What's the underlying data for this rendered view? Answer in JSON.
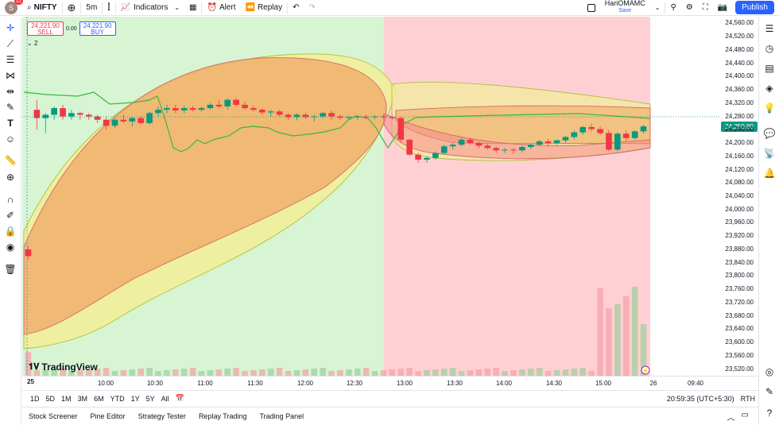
{
  "topbar": {
    "avatar_letter": "S",
    "notification_count": "11",
    "symbol": "NIFTY",
    "interval": "5m",
    "indicators_label": "Indicators",
    "alert_label": "Alert",
    "replay_label": "Replay",
    "layout_name": "HariOMAMC",
    "save_label": "Save",
    "publish_label": "Publish"
  },
  "quote": {
    "sell_price": "24,221.90",
    "sell_label": "SELL",
    "spread": "0.00",
    "buy_price": "24,221.90",
    "buy_label": "BUY",
    "legend_count": "2"
  },
  "price_axis": {
    "ticks": [
      "24,560.00",
      "24,520.00",
      "24,480.00",
      "24,440.00",
      "24,400.00",
      "24,360.00",
      "24,320.00",
      "24,280.00",
      "24,240.00",
      "24,200.00",
      "24,160.00",
      "24,120.00",
      "24,080.00",
      "24,040.00",
      "24,000.00",
      "23,960.00",
      "23,920.00",
      "23,880.00",
      "23,840.00",
      "23,800.00",
      "23,760.00",
      "23,720.00",
      "23,680.00",
      "23,640.00",
      "23,600.00",
      "23,560.00",
      "23,520.00"
    ],
    "last_price": "24,250.80",
    "last_price_color": "#089981"
  },
  "time_axis": {
    "day_label": "25",
    "ticks": [
      "10:00",
      "10:30",
      "11:00",
      "11:30",
      "12:00",
      "12:30",
      "13:00",
      "13:30",
      "14:00",
      "14:30",
      "15:00",
      "26",
      "09:40"
    ]
  },
  "watermark": "TradingView",
  "ranges": [
    "1D",
    "5D",
    "1M",
    "3M",
    "6M",
    "YTD",
    "1Y",
    "5Y",
    "All"
  ],
  "clock": "20:59:35 (UTC+5:30)",
  "session": "RTH",
  "bottom_tabs": [
    "Stock Screener",
    "Pine Editor",
    "Strategy Tester",
    "Replay Trading",
    "Trading Panel"
  ],
  "colors": {
    "up": "#089981",
    "down": "#f23645",
    "bg_green": "#d7f5d3",
    "bg_red": "#ffd0d3",
    "band_orange": "#f0b36f",
    "band_yellow": "#f2ee9a",
    "line_green": "#3cb83c",
    "accent": "#2962ff"
  },
  "chart_data": {
    "type": "candlestick",
    "y_range": [
      23500,
      24580
    ],
    "candles": [
      {
        "o": 23880,
        "h": 23890,
        "l": 23850,
        "c": 23860
      },
      {
        "o": 24300,
        "h": 24330,
        "l": 24240,
        "c": 24275
      },
      {
        "o": 24275,
        "h": 24290,
        "l": 24230,
        "c": 24285
      },
      {
        "o": 24285,
        "h": 24310,
        "l": 24270,
        "c": 24305
      },
      {
        "o": 24305,
        "h": 24315,
        "l": 24270,
        "c": 24280
      },
      {
        "o": 24280,
        "h": 24300,
        "l": 24270,
        "c": 24290
      },
      {
        "o": 24290,
        "h": 24295,
        "l": 24270,
        "c": 24285
      },
      {
        "o": 24285,
        "h": 24290,
        "l": 24270,
        "c": 24280
      },
      {
        "o": 24280,
        "h": 24285,
        "l": 24260,
        "c": 24270
      },
      {
        "o": 24270,
        "h": 24280,
        "l": 24240,
        "c": 24252
      },
      {
        "o": 24252,
        "h": 24275,
        "l": 24245,
        "c": 24270
      },
      {
        "o": 24270,
        "h": 24285,
        "l": 24260,
        "c": 24265
      },
      {
        "o": 24265,
        "h": 24280,
        "l": 24250,
        "c": 24275
      },
      {
        "o": 24275,
        "h": 24280,
        "l": 24255,
        "c": 24260
      },
      {
        "o": 24260,
        "h": 24295,
        "l": 24255,
        "c": 24290
      },
      {
        "o": 24290,
        "h": 24310,
        "l": 24280,
        "c": 24300
      },
      {
        "o": 24300,
        "h": 24315,
        "l": 24290,
        "c": 24305
      },
      {
        "o": 24305,
        "h": 24315,
        "l": 24290,
        "c": 24298
      },
      {
        "o": 24298,
        "h": 24312,
        "l": 24290,
        "c": 24305
      },
      {
        "o": 24305,
        "h": 24312,
        "l": 24295,
        "c": 24300
      },
      {
        "o": 24300,
        "h": 24310,
        "l": 24295,
        "c": 24305
      },
      {
        "o": 24305,
        "h": 24320,
        "l": 24300,
        "c": 24315
      },
      {
        "o": 24315,
        "h": 24330,
        "l": 24305,
        "c": 24310
      },
      {
        "o": 24310,
        "h": 24335,
        "l": 24300,
        "c": 24330
      },
      {
        "o": 24330,
        "h": 24335,
        "l": 24310,
        "c": 24315
      },
      {
        "o": 24315,
        "h": 24325,
        "l": 24300,
        "c": 24305
      },
      {
        "o": 24305,
        "h": 24312,
        "l": 24295,
        "c": 24300
      },
      {
        "o": 24300,
        "h": 24305,
        "l": 24285,
        "c": 24292
      },
      {
        "o": 24292,
        "h": 24300,
        "l": 24280,
        "c": 24295
      },
      {
        "o": 24295,
        "h": 24300,
        "l": 24280,
        "c": 24285
      },
      {
        "o": 24285,
        "h": 24290,
        "l": 24270,
        "c": 24278
      },
      {
        "o": 24278,
        "h": 24290,
        "l": 24268,
        "c": 24285
      },
      {
        "o": 24285,
        "h": 24290,
        "l": 24272,
        "c": 24278
      },
      {
        "o": 24278,
        "h": 24285,
        "l": 24265,
        "c": 24280
      },
      {
        "o": 24280,
        "h": 24295,
        "l": 24275,
        "c": 24290
      },
      {
        "o": 24290,
        "h": 24298,
        "l": 24270,
        "c": 24280
      },
      {
        "o": 24280,
        "h": 24285,
        "l": 24270,
        "c": 24276
      },
      {
        "o": 24276,
        "h": 24282,
        "l": 24270,
        "c": 24278
      },
      {
        "o": 24278,
        "h": 24282,
        "l": 24270,
        "c": 24280
      },
      {
        "o": 24280,
        "h": 24285,
        "l": 24272,
        "c": 24278
      },
      {
        "o": 24278,
        "h": 24283,
        "l": 24272,
        "c": 24280
      },
      {
        "o": 24280,
        "h": 24285,
        "l": 24273,
        "c": 24278
      },
      {
        "o": 24278,
        "h": 24285,
        "l": 24270,
        "c": 24275
      },
      {
        "o": 24275,
        "h": 24280,
        "l": 24200,
        "c": 24210
      },
      {
        "o": 24210,
        "h": 24212,
        "l": 24160,
        "c": 24165
      },
      {
        "o": 24165,
        "h": 24170,
        "l": 24140,
        "c": 24150
      },
      {
        "o": 24150,
        "h": 24160,
        "l": 24140,
        "c": 24155
      },
      {
        "o": 24155,
        "h": 24175,
        "l": 24150,
        "c": 24170
      },
      {
        "o": 24170,
        "h": 24195,
        "l": 24165,
        "c": 24190
      },
      {
        "o": 24190,
        "h": 24200,
        "l": 24180,
        "c": 24195
      },
      {
        "o": 24195,
        "h": 24215,
        "l": 24190,
        "c": 24210
      },
      {
        "o": 24210,
        "h": 24215,
        "l": 24195,
        "c": 24200
      },
      {
        "o": 24200,
        "h": 24205,
        "l": 24185,
        "c": 24192
      },
      {
        "o": 24192,
        "h": 24198,
        "l": 24180,
        "c": 24185
      },
      {
        "o": 24185,
        "h": 24190,
        "l": 24170,
        "c": 24178
      },
      {
        "o": 24178,
        "h": 24185,
        "l": 24170,
        "c": 24180
      },
      {
        "o": 24180,
        "h": 24185,
        "l": 24168,
        "c": 24178
      },
      {
        "o": 24178,
        "h": 24192,
        "l": 24172,
        "c": 24188
      },
      {
        "o": 24188,
        "h": 24200,
        "l": 24182,
        "c": 24195
      },
      {
        "o": 24195,
        "h": 24210,
        "l": 24190,
        "c": 24205
      },
      {
        "o": 24205,
        "h": 24212,
        "l": 24190,
        "c": 24200
      },
      {
        "o": 24200,
        "h": 24210,
        "l": 24195,
        "c": 24208
      },
      {
        "o": 24208,
        "h": 24222,
        "l": 24200,
        "c": 24218
      },
      {
        "o": 24218,
        "h": 24238,
        "l": 24210,
        "c": 24232
      },
      {
        "o": 24232,
        "h": 24252,
        "l": 24225,
        "c": 24248
      },
      {
        "o": 24248,
        "h": 24258,
        "l": 24235,
        "c": 24242
      },
      {
        "o": 24242,
        "h": 24250,
        "l": 24225,
        "c": 24230
      },
      {
        "o": 24230,
        "h": 24240,
        "l": 24175,
        "c": 24180
      },
      {
        "o": 24180,
        "h": 24232,
        "l": 24175,
        "c": 24228
      },
      {
        "o": 24228,
        "h": 24238,
        "l": 24205,
        "c": 24215
      },
      {
        "o": 24215,
        "h": 24238,
        "l": 24210,
        "c": 24235
      },
      {
        "o": 24235,
        "h": 24255,
        "l": 24228,
        "c": 24250
      }
    ]
  }
}
